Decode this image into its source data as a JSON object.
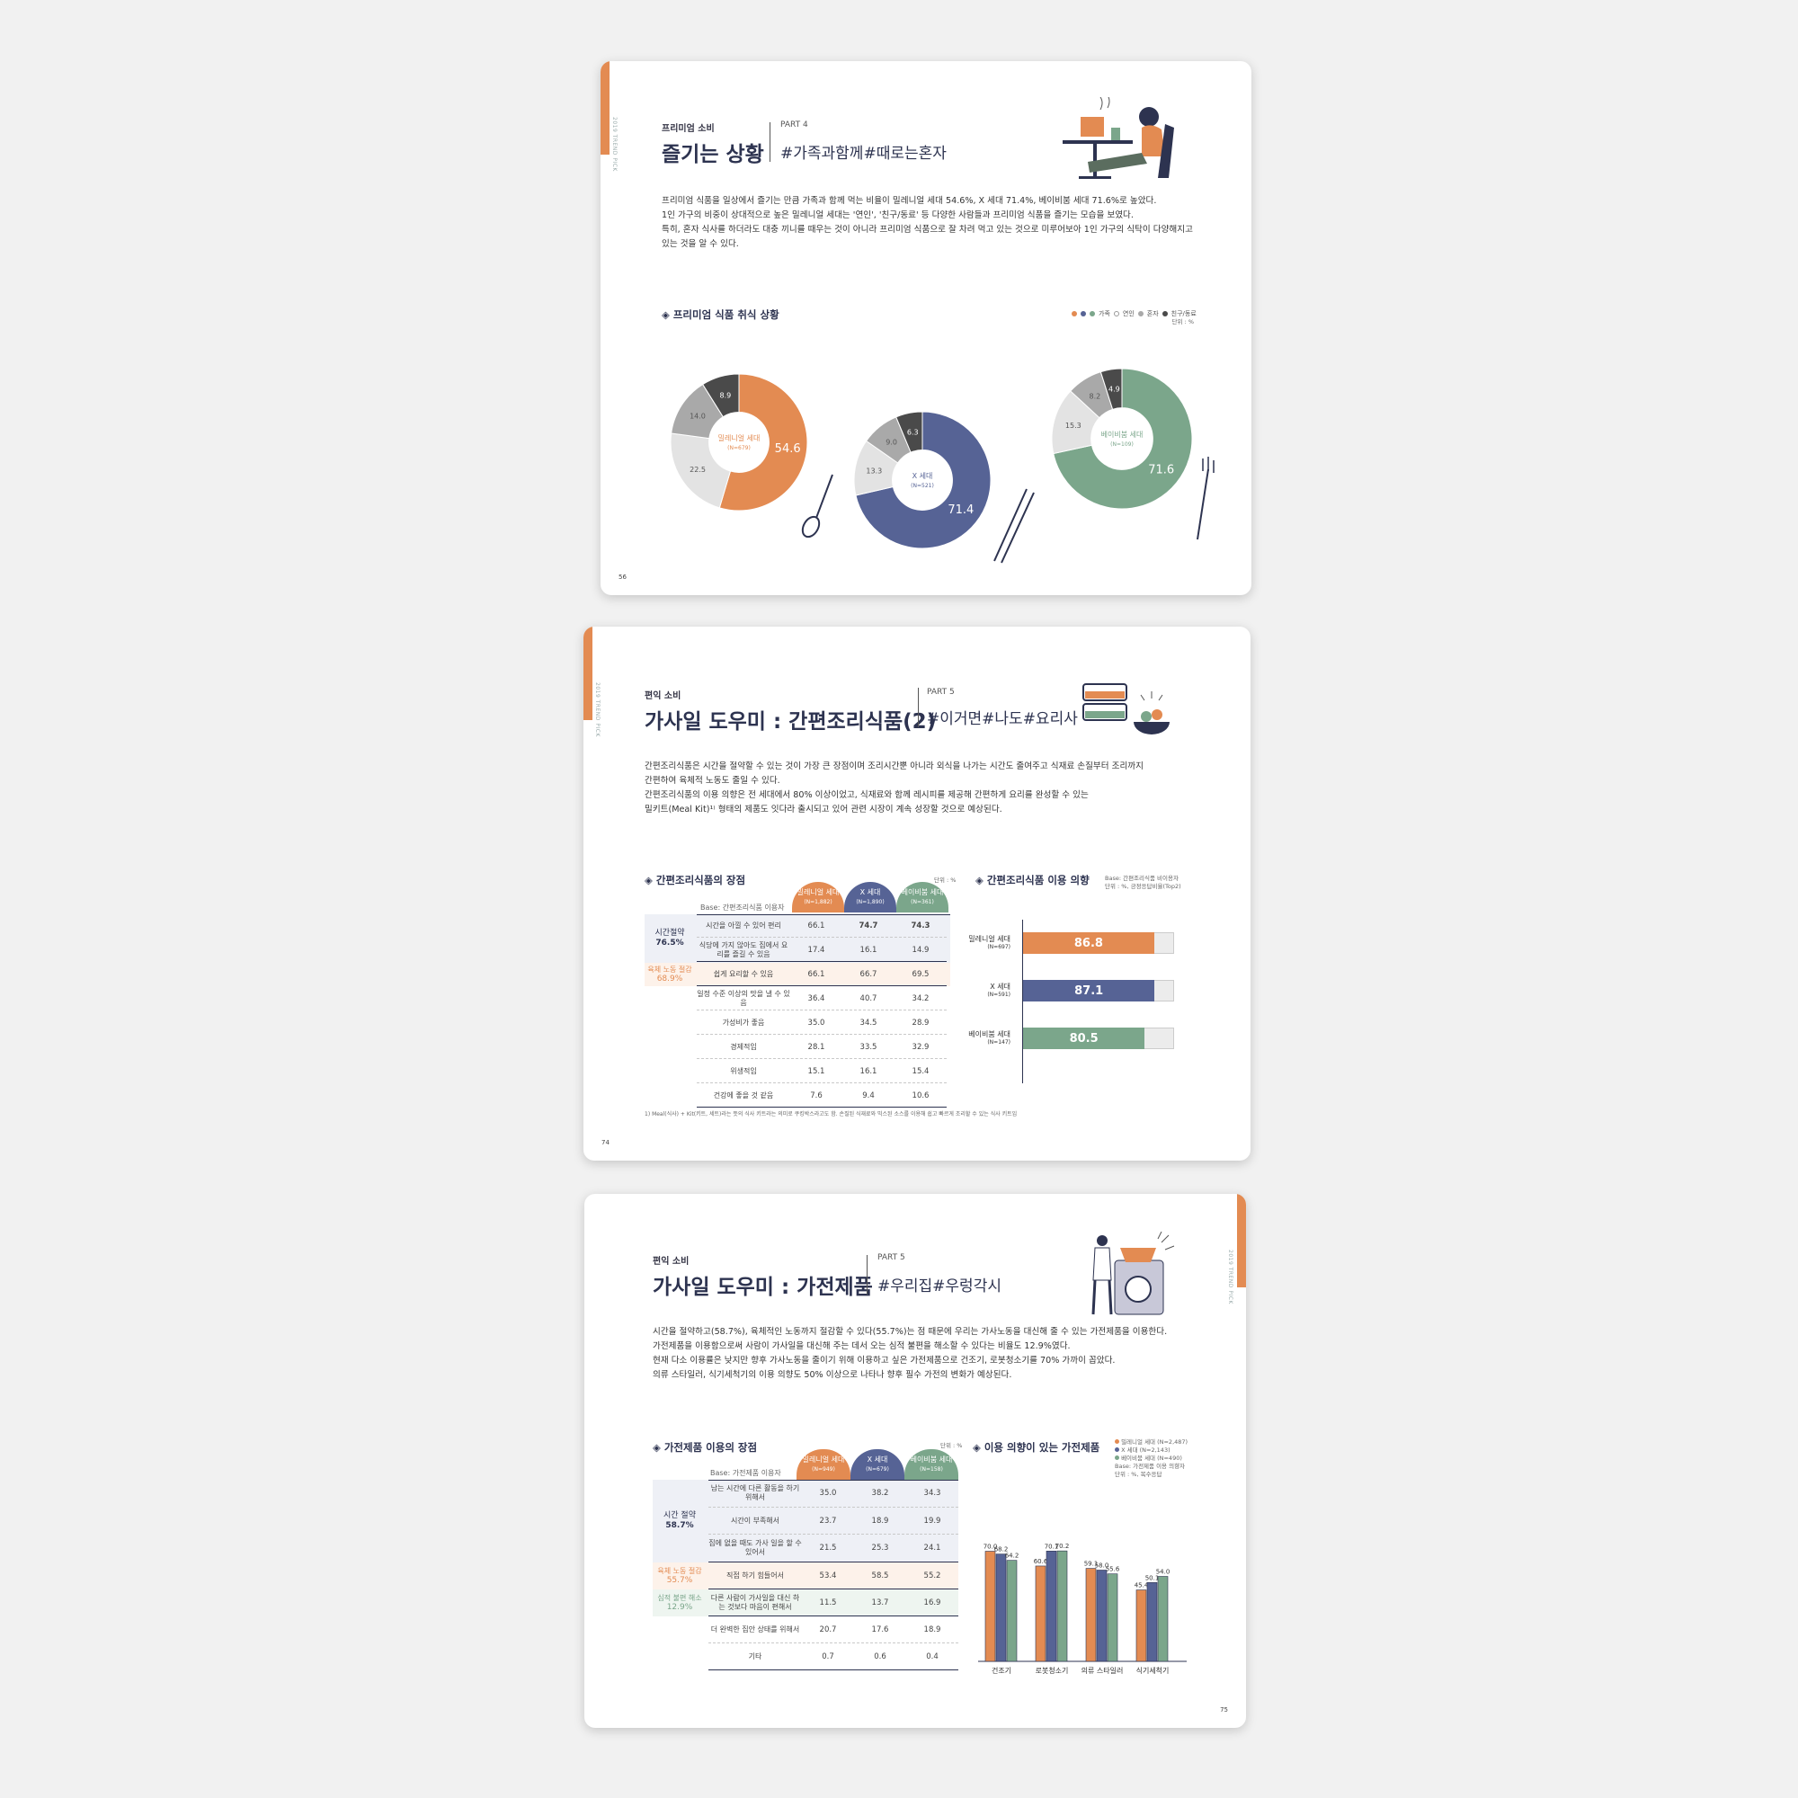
{
  "page1": {
    "vertical_label": "2019 TREND PICK",
    "category": "프리미엄 소비",
    "title": "즐기는 상황",
    "part": "PART 4",
    "hashtags": "#가족과함께#때로는혼자",
    "paragraphs": [
      "프리미엄 식품을 일상에서 즐기는 만큼 가족과 함께 먹는 비율이 밀레니얼 세대 54.6%, X 세대 71.4%, 베이비붐 세대 71.6%로 높았다.",
      "1인 가구의 비중이 상대적으로 높은 밀레니얼 세대는 '연인', '친구/동료' 등 다양한 사람들과 프리미엄 식품을 즐기는 모습을 보였다.",
      "특히, 혼자 식사를 하더라도 대충 끼니를 때우는 것이 아니라 프리미엄 식품으로 잘 차려 먹고 있는 것으로 미루어보아 1인 가구의 식탁이 다양해지고",
      "있는 것을 알 수 있다."
    ],
    "section_title": "◈ 프리미엄 식품 취식 상황",
    "legend": [
      "가족",
      "연인",
      "혼자",
      "친구/동료"
    ],
    "unit": "단위 : %",
    "page_number": "56"
  },
  "page2": {
    "vertical_label": "2019 TREND PICK",
    "category": "편익 소비",
    "title": "가사일 도우미 : 간편조리식품(2)",
    "part": "PART 5",
    "hashtags": "#이거면#나도#요리사",
    "paragraphs": [
      "간편조리식품은 시간을 절약할 수 있는 것이 가장 큰 장점이며 조리시간뿐 아니라 외식을 나가는 시간도 줄여주고 식재료 손질부터 조리까지",
      "간편하여 육체적 노동도 줄일 수 있다.",
      "간편조리식품의 이용 의향은 전 세대에서 80% 이상이었고, 식재료와 함께 레시피를 제공해 간편하게 요리를 완성할 수 있는",
      "밀키트(Meal Kit)¹⁾ 형태의 제품도 잇다라 출시되고 있어 관련 시장이 계속 성장할 것으로 예상된다."
    ],
    "table_title": "◈ 간편조리식품의 장점",
    "table_unit": "단위 : %",
    "table_base": "Base: 간편조리식품 이용자",
    "columns": [
      {
        "name": "밀레니얼 세대",
        "n": "(N=1,882)"
      },
      {
        "name": "X 세대",
        "n": "(N=1,890)"
      },
      {
        "name": "베이비붐 세대",
        "n": "(N=361)"
      }
    ],
    "groups": [
      {
        "label": "시간절약",
        "value": "76.5%"
      },
      {
        "label": "육체 노동 절감",
        "value": "68.9%"
      }
    ],
    "rows": [
      {
        "label": "시간을 아낄 수 있어 편리",
        "values": [
          "66.1",
          "74.7",
          "74.3"
        ]
      },
      {
        "label": "식당에 가지 않아도 집에서 요리를 즐길 수 있음",
        "values": [
          "17.4",
          "16.1",
          "14.9"
        ]
      },
      {
        "label": "쉽게 요리할 수 있음",
        "values": [
          "66.1",
          "66.7",
          "69.5"
        ]
      },
      {
        "label": "일정 수준 이상의 맛을 낼 수 있음",
        "values": [
          "36.4",
          "40.7",
          "34.2"
        ]
      },
      {
        "label": "가성비가 좋음",
        "values": [
          "35.0",
          "34.5",
          "28.9"
        ]
      },
      {
        "label": "경제적임",
        "values": [
          "28.1",
          "33.5",
          "32.9"
        ]
      },
      {
        "label": "위생적임",
        "values": [
          "15.1",
          "16.1",
          "15.4"
        ]
      },
      {
        "label": "건강에 좋을 것 같음",
        "values": [
          "7.6",
          "9.4",
          "10.6"
        ]
      }
    ],
    "intent_title": "◈ 간편조리식품 이용 의향",
    "intent_note": [
      "Base: 간편조리식품 비이용자",
      "단위 : %, 긍정응답비율(Top2)"
    ],
    "intent_bars": [
      {
        "name": "밀레니얼 세대",
        "n": "(N=697)",
        "value": 86.8,
        "label": "86.8",
        "color": "#e38b52"
      },
      {
        "name": "X 세대",
        "n": "(N=591)",
        "value": 87.1,
        "label": "87.1",
        "color": "#566395"
      },
      {
        "name": "베이비붐 세대",
        "n": "(N=147)",
        "value": 80.5,
        "label": "80.5",
        "color": "#7ba68b"
      }
    ],
    "footnote": "1) Meal(식사) + Kit(키트, 세트)라는 뜻의 식사 키트라는 의미로 쿠킹박스라고도 함. 손질된 식재료와 믹스된 소스를 이용해 쉽고 빠르게 조리할 수 있는 식사 키트임",
    "page_number": "74"
  },
  "page3": {
    "vertical_label": "2019 TREND PICK",
    "category": "편익 소비",
    "title": "가사일 도우미 : 가전제품",
    "part": "PART 5",
    "hashtags": "#우리집#우렁각시",
    "paragraphs": [
      "시간을 절약하고(58.7%), 육체적인 노동까지 절감할 수 있다(55.7%)는 점 때문에 우리는 가사노동을 대신해 줄 수 있는 가전제품을 이용한다.",
      "가전제품을 이용함으로써 사람이 가사일을 대신해 주는 데서 오는 심적 불편을 해소할 수 있다는 비율도 12.9%였다.",
      "현재 다소 이용률은 낮지만 향후 가사노동을 줄이기 위해 이용하고 싶은 가전제품으로 건조기, 로봇청소기를 70% 가까이 꼽았다.",
      "의류 스타일러, 식기세척기의 이용 의향도 50% 이상으로 나타나 향후 필수 가전의 변화가 예상된다."
    ],
    "table_title": "◈ 가전제품 이용의 장점",
    "table_unit": "단위 : %",
    "table_base": "Base: 가전제품 이용자",
    "columns": [
      {
        "name": "밀레니얼 세대",
        "n": "(N=949)"
      },
      {
        "name": "X 세대",
        "n": "(N=679)"
      },
      {
        "name": "베이비붐 세대",
        "n": "(N=158)"
      }
    ],
    "groups": [
      {
        "label": "시간 절약",
        "value": "58.7%"
      },
      {
        "label": "육체 노동 절감",
        "value": "55.7%"
      },
      {
        "label": "심적 불편 해소",
        "value": "12.9%"
      }
    ],
    "rows": [
      {
        "label": "남는 시간에 다른 활동을 하기 위해서",
        "values": [
          "35.0",
          "38.2",
          "34.3"
        ]
      },
      {
        "label": "시간이 부족해서",
        "values": [
          "23.7",
          "18.9",
          "19.9"
        ]
      },
      {
        "label": "집에 없을 때도 가사 일을 할 수 있어서",
        "values": [
          "21.5",
          "25.3",
          "24.1"
        ]
      },
      {
        "label": "직접 하기 힘들어서",
        "values": [
          "53.4",
          "58.5",
          "55.2"
        ]
      },
      {
        "label": "다른 사람이 가사일을 대신 하는 것보다 마음이 편해서",
        "values": [
          "11.5",
          "13.7",
          "16.9"
        ]
      },
      {
        "label": "더 완벽한 집안 상태를 위해서",
        "values": [
          "20.7",
          "17.6",
          "18.9"
        ]
      },
      {
        "label": "기타",
        "values": [
          "0.7",
          "0.6",
          "0.4"
        ]
      }
    ],
    "chart_title": "◈ 이용 의향이 있는 가전제품",
    "chart_legend": [
      {
        "name": "밀레니얼 세대 (N=2,487)",
        "color": "#e38b52"
      },
      {
        "name": "X 세대 (N=2,143)",
        "color": "#566395"
      },
      {
        "name": "베이비붐 세대 (N=490)",
        "color": "#7ba68b"
      }
    ],
    "chart_note": [
      "Base: 가전제품 이용 의향자",
      "단위 : %, 복수응답"
    ],
    "page_number": "75"
  },
  "chart_data": [
    {
      "type": "pie",
      "title": "밀레니얼 세대",
      "subtitle": "(N=679)",
      "categories": [
        "가족",
        "연인",
        "혼자",
        "친구/동료"
      ],
      "values": [
        54.6,
        22.5,
        14.0,
        8.9
      ],
      "colors": [
        "#e38b52",
        "#e3e3e3",
        "#a9a9a9",
        "#4a4a4a"
      ]
    },
    {
      "type": "pie",
      "title": "X 세대",
      "subtitle": "(N=521)",
      "categories": [
        "가족",
        "연인",
        "혼자",
        "친구/동료"
      ],
      "values": [
        71.4,
        13.3,
        9.0,
        6.3
      ],
      "colors": [
        "#566395",
        "#e3e3e3",
        "#a9a9a9",
        "#4a4a4a"
      ]
    },
    {
      "type": "pie",
      "title": "베이비붐 세대",
      "subtitle": "(N=109)",
      "categories": [
        "가족",
        "연인",
        "혼자",
        "친구/동료"
      ],
      "values": [
        71.6,
        15.3,
        8.2,
        4.9
      ],
      "colors": [
        "#7ba68b",
        "#e3e3e3",
        "#a9a9a9",
        "#4a4a4a"
      ]
    },
    {
      "type": "bar",
      "categories": [
        "건조기",
        "로봇청소기",
        "의류 스타일러",
        "식기세척기"
      ],
      "series": [
        {
          "name": "밀레니얼 세대 (N=2,487)",
          "values": [
            70.0,
            60.6,
            59.1,
            45.4
          ]
        },
        {
          "name": "X 세대 (N=2,143)",
          "values": [
            68.2,
            70.1,
            58.0,
            50.1
          ]
        },
        {
          "name": "베이비붐 세대 (N=490)",
          "values": [
            64.2,
            70.2,
            55.6,
            54.0
          ]
        }
      ],
      "value_labels": [
        [
          "70.0",
          "60.6",
          "59.1",
          "45.4"
        ],
        [
          "68.2",
          "70.1",
          "58.0",
          "50.1"
        ],
        [
          "64.2",
          "70.2",
          "55.6",
          "54.0"
        ]
      ],
      "ylim": [
        0,
        80
      ]
    }
  ]
}
